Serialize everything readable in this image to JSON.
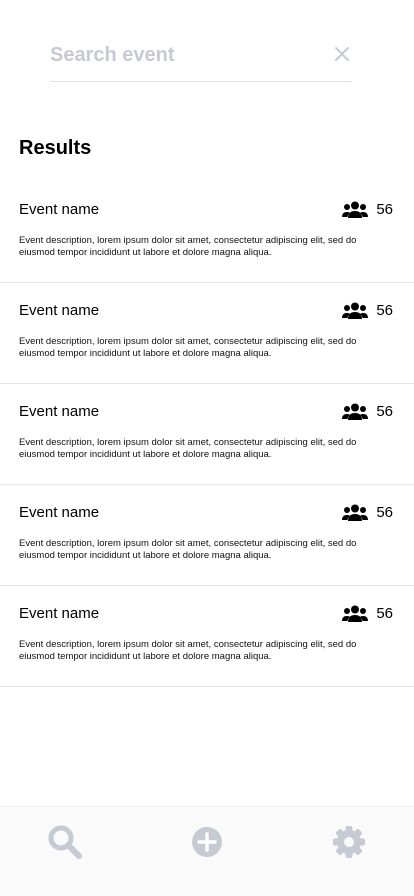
{
  "search": {
    "placeholder": "Search event",
    "value": ""
  },
  "results": {
    "title": "Results"
  },
  "events": [
    {
      "name": "Event name",
      "count": "56",
      "description": "Event description, lorem ipsum dolor sit amet, consectetur adipiscing elit, sed do eiusmod tempor incididunt ut labore et dolore magna aliqua."
    },
    {
      "name": "Event name",
      "count": "56",
      "description": "Event description, lorem ipsum dolor sit amet, consectetur adipiscing elit, sed do eiusmod tempor incididunt ut labore et dolore magna aliqua."
    },
    {
      "name": "Event name",
      "count": "56",
      "description": "Event description, lorem ipsum dolor sit amet, consectetur adipiscing elit, sed do eiusmod tempor incididunt ut labore et dolore magna aliqua."
    },
    {
      "name": "Event name",
      "count": "56",
      "description": "Event description, lorem ipsum dolor sit amet, consectetur adipiscing elit, sed do eiusmod tempor incididunt ut labore et dolore magna aliqua."
    },
    {
      "name": "Event name",
      "count": "56",
      "description": "Event description, lorem ipsum dolor sit amet, consectetur adipiscing elit, sed do eiusmod tempor incididunt ut labore et dolore magna aliqua."
    }
  ],
  "icons": {
    "clear": "close-icon",
    "attendees": "people-icon",
    "nav_search": "search-icon",
    "nav_add": "add-circle-icon",
    "nav_settings": "gear-icon"
  },
  "colors": {
    "placeholder": "#c6cad2",
    "icon_muted": "#c6cad2",
    "text": "#000000",
    "divider": "#e6e6e6",
    "nav_background": "#fafafa"
  }
}
